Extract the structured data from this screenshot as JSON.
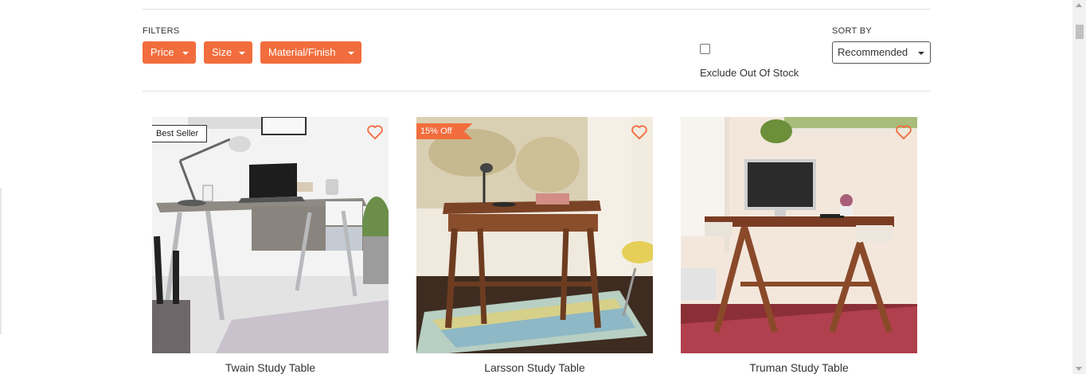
{
  "filters": {
    "label": "FILTERS",
    "buttons": [
      "Price",
      "Size",
      "Material/Finish"
    ]
  },
  "stock": {
    "label": "Exclude Out Of Stock",
    "checked": false
  },
  "sort": {
    "label": "SORT BY",
    "value": "Recommended"
  },
  "products": [
    {
      "name": "Twain Study Table",
      "badge": "Best Seller"
    },
    {
      "name": "Larsson Study Table",
      "badge": "15% Off"
    },
    {
      "name": "Truman Study Table",
      "badge": ""
    }
  ],
  "colors": {
    "accent": "#f26d3d"
  },
  "icons": {
    "wishlist": "heart-outline-icon",
    "dropdown": "caret-down-icon"
  }
}
